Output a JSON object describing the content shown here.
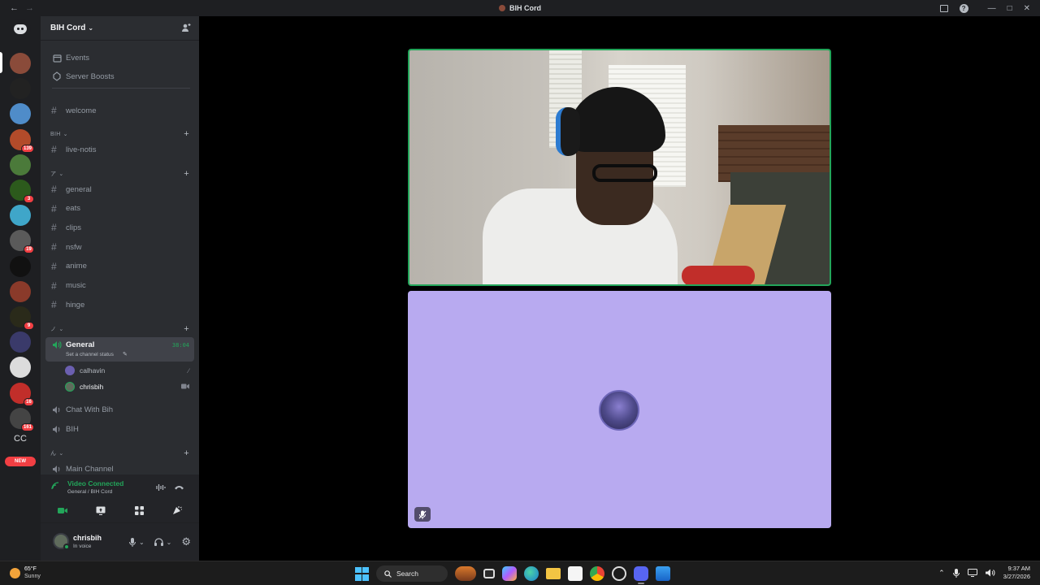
{
  "window": {
    "title": "BIH Cord",
    "back_label": "←",
    "forward_label": "→",
    "minimize_label": "—",
    "maximize_label": "□",
    "close_label": "✕",
    "help_label": "?"
  },
  "servers": {
    "items": [
      {
        "name": "server-1",
        "color": "#8a4b3a"
      },
      {
        "name": "server-2",
        "color": "#222222"
      },
      {
        "name": "server-3",
        "color": "#4f8cc9"
      },
      {
        "name": "server-4",
        "color": "#b34b2a",
        "badge": "139"
      },
      {
        "name": "server-5",
        "color": "#4b7a3a"
      },
      {
        "name": "server-6",
        "color": "#2c5a1c",
        "badge": "3"
      },
      {
        "name": "server-7",
        "color": "#3fa6c9"
      },
      {
        "name": "server-8",
        "color": "#5a5a5a",
        "badge": "19"
      },
      {
        "name": "server-9",
        "color": "#111111"
      },
      {
        "name": "server-10",
        "color": "#8a3a2a"
      },
      {
        "name": "server-11",
        "color": "#2a2a1a",
        "badge": "9"
      },
      {
        "name": "server-12",
        "color": "#3a3a6a"
      },
      {
        "name": "server-13",
        "color": "#dcdcdc"
      },
      {
        "name": "server-14",
        "color": "#c12e2a",
        "badge": "16"
      },
      {
        "name": "server-15",
        "color": "#444444",
        "badge": "161"
      }
    ],
    "cc_label": "CC",
    "new_label": "NEW"
  },
  "guild": {
    "name": "BIH Cord"
  },
  "sidebar": {
    "top_links": [
      {
        "label": "Events"
      },
      {
        "label": "Server Boosts"
      }
    ],
    "welcome": "welcome",
    "categories": [
      {
        "label": "BIH"
      },
      {
        "label": "ア"
      },
      {
        "label": "ノ"
      },
      {
        "label": "ん"
      }
    ],
    "bih_channels": [
      "live-notis"
    ],
    "text_channels": [
      "general",
      "eats",
      "clips",
      "nsfw",
      "anime",
      "music",
      "hinge"
    ],
    "voice_active": {
      "name": "General",
      "timer": "38:04",
      "status": "Set a channel status"
    },
    "members": [
      {
        "name": "calhavin",
        "color": "#6b5fb0"
      },
      {
        "name": "chrisbih",
        "color": "#5f6b5c"
      }
    ],
    "voice_channels": [
      "Chat With Bih",
      "BIH"
    ],
    "last_channel": "Main Channel"
  },
  "voice": {
    "status": "Video Connected",
    "sub": "General / BIH Cord"
  },
  "user": {
    "name": "chrisbih",
    "status": "In voice"
  },
  "taskbar": {
    "temp": "65°F",
    "condition": "Sunny",
    "search_label": "Search",
    "time": "9:37 AM",
    "date": "3/27/2026"
  },
  "colors": {
    "accent_green": "#23a55a",
    "tile_purple": "#b8aaf0",
    "badge_red": "#f23f43"
  }
}
